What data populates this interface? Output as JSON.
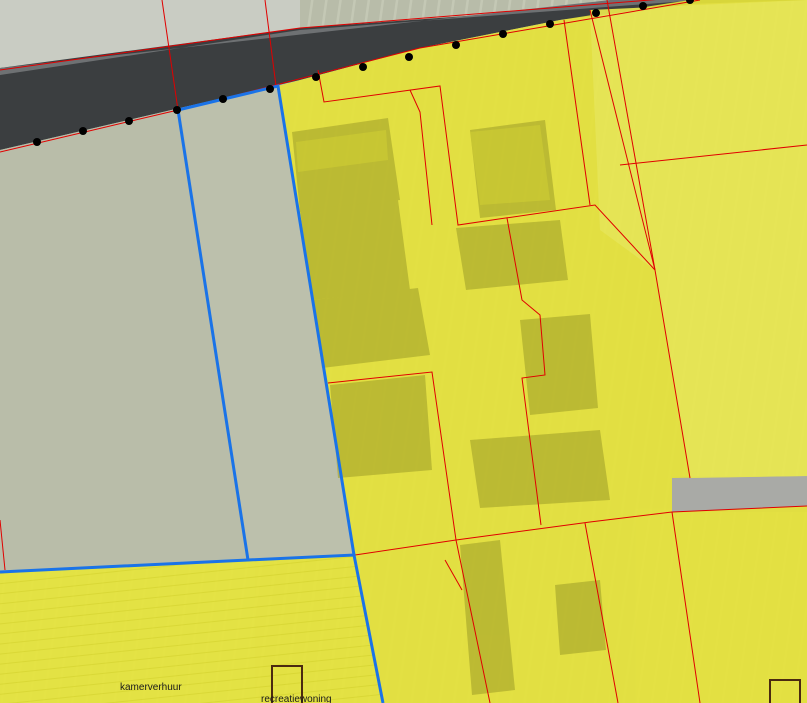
{
  "map": {
    "labels": {
      "kamerverhuur": "kamerverhuur",
      "recreatiewoning": "recreatiewoning"
    },
    "colors": {
      "zone_highlight": "#e6e600",
      "parcel_boundary": "#e00000",
      "selected_parcel": "#1a73e8",
      "road": "#3a3d3f",
      "field": "#b7bba8",
      "markers": "#000000"
    }
  }
}
